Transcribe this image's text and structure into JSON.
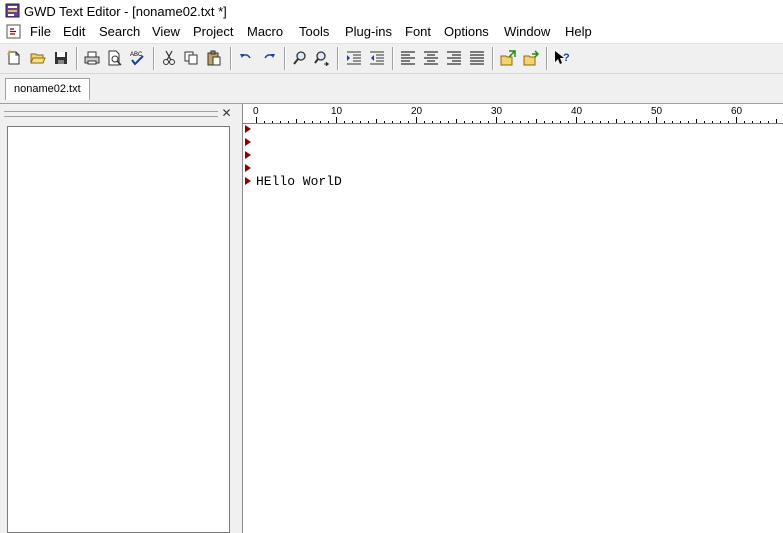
{
  "window": {
    "title": "GWD Text Editor - [noname02.txt *]"
  },
  "menu": {
    "items": [
      "File",
      "Edit",
      "Search",
      "View",
      "Project",
      "Macro",
      "Tools",
      "Plug-ins",
      "Font",
      "Options",
      "Window",
      "Help"
    ]
  },
  "toolbar": {
    "buttons": [
      "new-file",
      "open-folder",
      "save",
      "print",
      "print-preview",
      "spell-check",
      "cut",
      "copy",
      "paste",
      "undo",
      "redo",
      "find",
      "find-replace",
      "indent",
      "outdent",
      "align-left",
      "align-center",
      "align-right",
      "justify",
      "previous-file",
      "next-file",
      "context-help"
    ]
  },
  "tabs": [
    {
      "label": "noname02.txt",
      "active": true
    }
  ],
  "ruler": {
    "labels": [
      "0",
      "10",
      "20",
      "30",
      "40",
      "50",
      "60"
    ]
  },
  "editor": {
    "lines": [
      "",
      "",
      "",
      "",
      "HEllo WorlD"
    ]
  },
  "colors": {
    "line_marker": "#8b0000",
    "toolbar_bg": "#f0f0f0"
  }
}
